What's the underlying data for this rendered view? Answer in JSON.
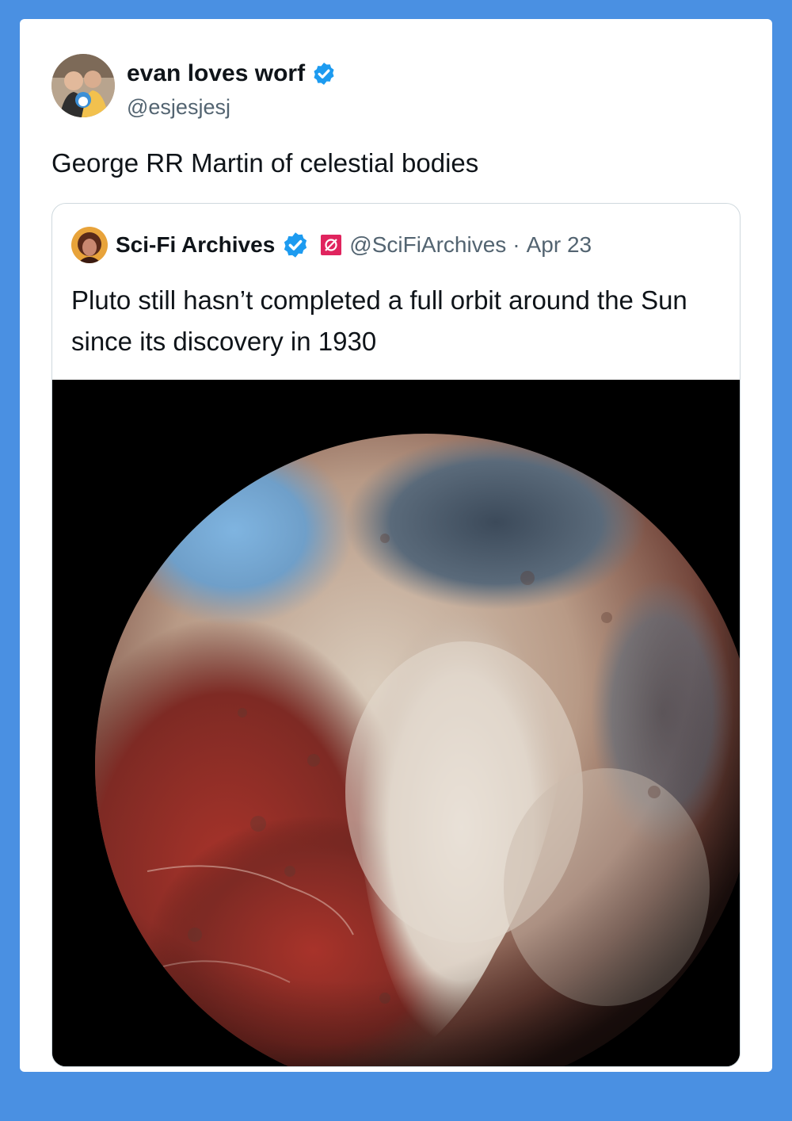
{
  "tweet": {
    "author_name": "evan loves worf",
    "author_handle": "@esjesjesj",
    "text": "George RR Martin of celestial bodies"
  },
  "quoted": {
    "author_name": "Sci-Fi Archives",
    "author_handle": "@SciFiArchives",
    "separator": "·",
    "date": "Apr 23",
    "text": "Pluto still hasn’t completed a full orbit around the Sun since its discovery in 1930"
  },
  "colors": {
    "background": "#4a90e2",
    "verified": "#1d9bf0",
    "badge": "#e0245e"
  }
}
